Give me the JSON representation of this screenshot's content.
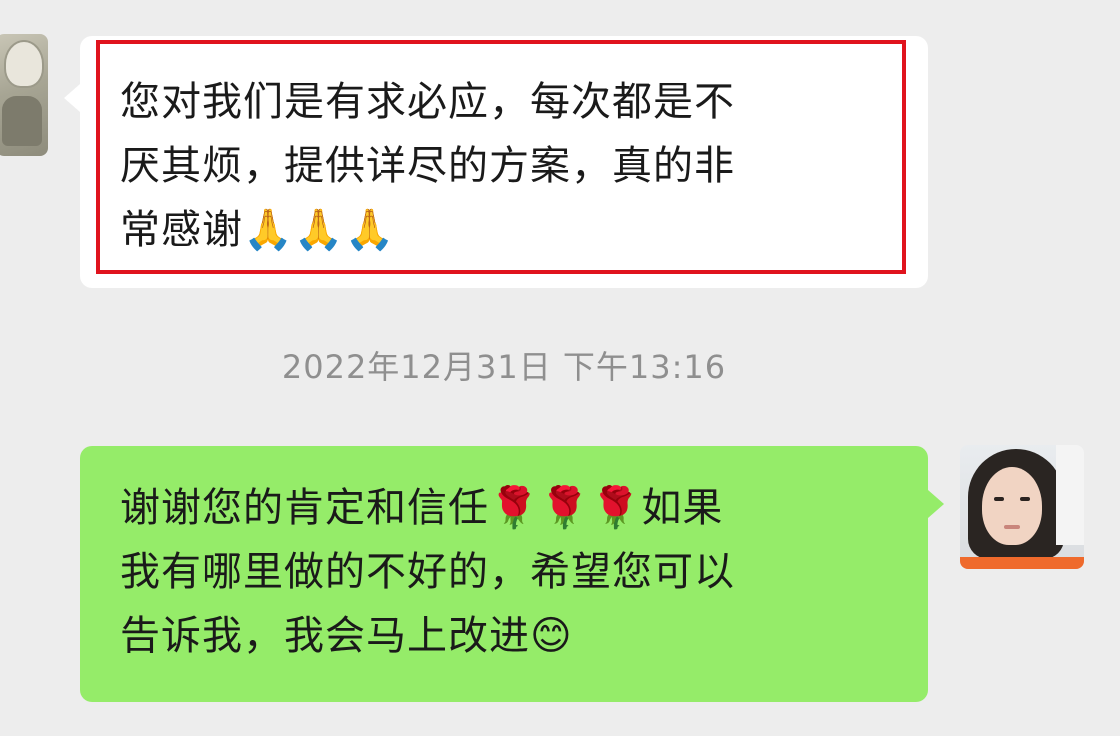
{
  "messages": [
    {
      "direction": "incoming",
      "lines": [
        "您对我们是有求必应，每次都是不",
        "厌其烦，提供详尽的方案，真的非",
        "常感谢🙏🙏🙏"
      ]
    },
    {
      "direction": "outgoing",
      "lines": [
        "谢谢您的肯定和信任🌹🌹🌹如果",
        "我有哪里做的不好的，希望您可以",
        "告诉我，我会马上改进😊"
      ]
    }
  ],
  "timestamp": "2022年12月31日 下午13:16",
  "colors": {
    "background": "#ededed",
    "incoming_bubble": "#ffffff",
    "outgoing_bubble": "#95ec69",
    "highlight_border": "#e0131d",
    "timestamp_text": "#8f8f8f"
  },
  "icons": {
    "incoming_avatar": "avatar-image",
    "outgoing_avatar": "avatar-image"
  }
}
